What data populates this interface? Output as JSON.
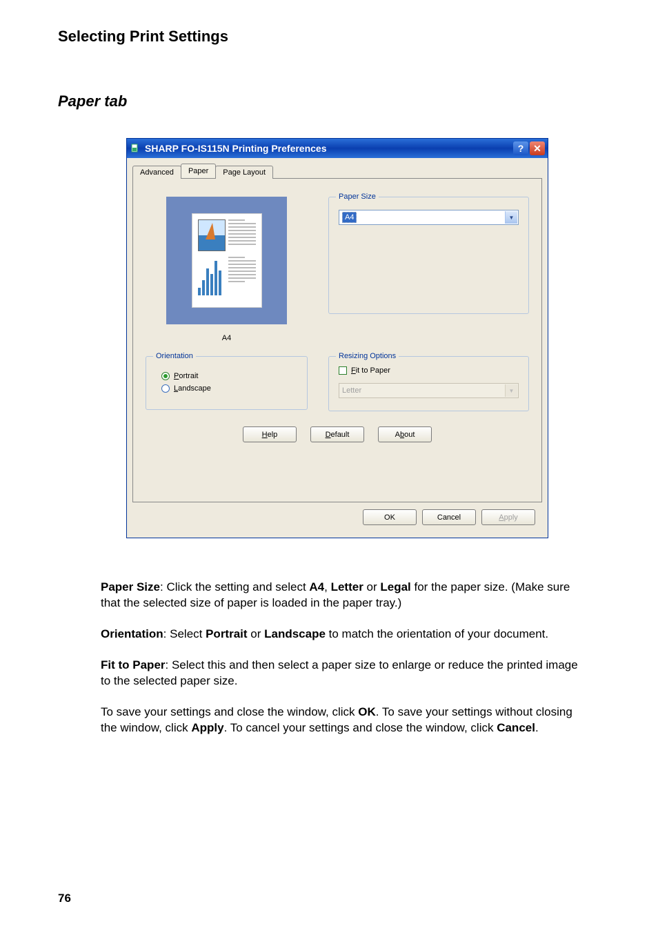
{
  "page": {
    "heading": "Selecting Print Settings",
    "section": "Paper tab",
    "number": "76"
  },
  "dialog": {
    "title": "SHARP FO-IS115N Printing Preferences",
    "help_icon": "?",
    "close_icon": "✕",
    "tabs": [
      "Advanced",
      "Paper",
      "Page Layout"
    ],
    "active_tab": "Paper",
    "preview_label": "A4",
    "paper_size": {
      "legend": "Paper Size",
      "value": "A4"
    },
    "orientation": {
      "legend": "Orientation",
      "options": [
        {
          "label_pre": "",
          "underline": "P",
          "label_post": "ortrait",
          "checked": true
        },
        {
          "label_pre": "",
          "underline": "L",
          "label_post": "andscape",
          "checked": false
        }
      ]
    },
    "resizing": {
      "legend": "Resizing Options",
      "checkbox": {
        "underline": "F",
        "label_post": "it to Paper",
        "checked": false
      },
      "target": "Letter"
    },
    "buttons": {
      "help": {
        "underline": "H",
        "post": "elp"
      },
      "default": {
        "underline": "D",
        "post": "efault"
      },
      "about": {
        "pre": "A",
        "underline": "b",
        "post": "out"
      },
      "ok": "OK",
      "cancel": "Cancel",
      "apply": {
        "underline": "A",
        "post": "pply"
      }
    }
  },
  "paras": {
    "p1": {
      "b1": "Paper Size",
      "t1": ": Click the setting and select ",
      "b2": "A4",
      "t2": ", ",
      "b3": "Letter",
      "t3": " or ",
      "b4": "Legal",
      "t4": " for the paper size. (Make sure that the selected size of paper is loaded in the paper tray.)"
    },
    "p2": {
      "b1": "Orientation",
      "t1": ": Select ",
      "b2": "Portrait",
      "t2": " or ",
      "b3": "Landscape",
      "t3": " to match the orientation of your document."
    },
    "p3": {
      "b1": "Fit to Paper",
      "t1": ": Select this and then select a paper size to enlarge or reduce the printed image to the selected paper size."
    },
    "p4": {
      "t1": "To save your settings and close the window, click ",
      "b1": "OK",
      "t2": ". To save your settings without closing the window, click ",
      "b2": "Apply",
      "t3": ". To cancel your settings and close the window, click ",
      "b3": "Cancel",
      "t4": "."
    }
  }
}
